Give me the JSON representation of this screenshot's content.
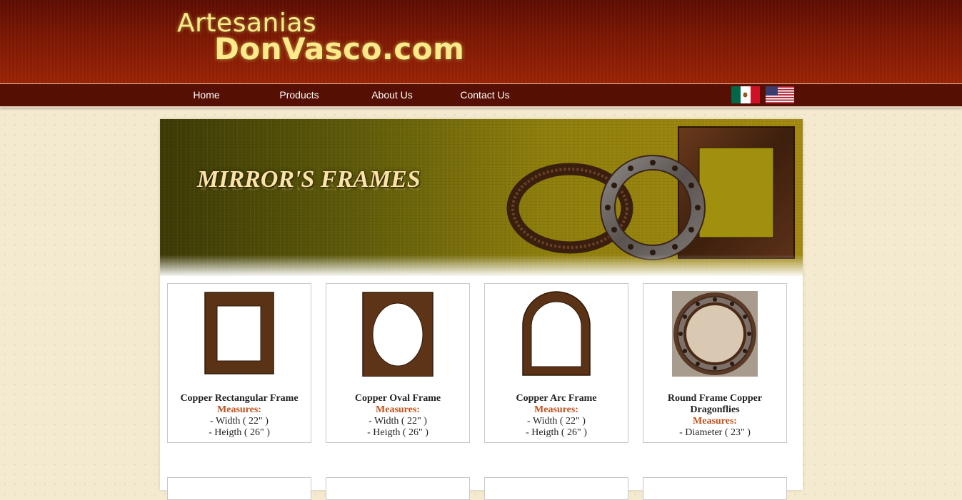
{
  "site": {
    "logo_line1": "Artesanias",
    "logo_line2": "DonVasco.com"
  },
  "nav": {
    "items": [
      {
        "label": "Home"
      },
      {
        "label": "Products"
      },
      {
        "label": "About Us"
      },
      {
        "label": "Contact Us"
      }
    ],
    "flags": [
      "mexico-flag-icon",
      "usa-flag-icon"
    ]
  },
  "banner": {
    "title": "MIRROR'S FRAMES"
  },
  "products": [
    {
      "name": "Copper Rectangular Frame",
      "measures_label": "Measures:",
      "lines": [
        "- Width ( 22\" )",
        "- Heigth ( 26\" )"
      ],
      "icon": "rectangular-frame-icon"
    },
    {
      "name": "Copper Oval Frame",
      "measures_label": "Measures:",
      "lines": [
        "- Width ( 22\" )",
        "- Heigth ( 26\" )"
      ],
      "icon": "oval-frame-icon"
    },
    {
      "name": "Copper Arc Frame",
      "measures_label": "Measures:",
      "lines": [
        "- Width ( 22\" )",
        "- Heigth ( 26\" )"
      ],
      "icon": "arc-frame-icon"
    },
    {
      "name": "Round Frame Copper Dragonflies",
      "measures_label": "Measures:",
      "lines": [
        "- Diameter ( 23\" )",
        ""
      ],
      "icon": "round-frame-icon"
    }
  ],
  "colors": {
    "header": "#7a1704",
    "navbar": "#560f03",
    "logo_text": "#ffe98a",
    "measures": "#c0501a",
    "page_bg": "#f4ead0"
  }
}
